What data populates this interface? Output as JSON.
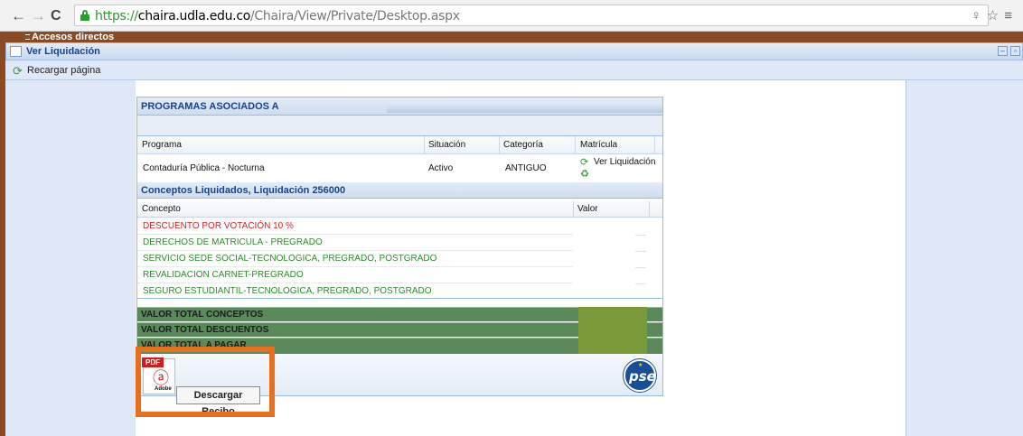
{
  "browser": {
    "url_scheme": "https://",
    "url_host": "chaira.udla.edu.co",
    "url_path": "/Chaira/View/Private/Desktop.aspx"
  },
  "app": {
    "shortcuts_label": "Accesos directos"
  },
  "window": {
    "title": "Ver Liquidación"
  },
  "toolbar": {
    "reload_label": "Recargar página"
  },
  "programs": {
    "header": "PROGRAMAS ASOCIADOS A",
    "columns": [
      "Programa",
      "Situación",
      "Categoría",
      "Matrícula"
    ],
    "rows": [
      {
        "programa": "Contaduría Pública - Nocturna",
        "situacion": "Activo",
        "categoria": "ANTIGUO",
        "matricula_link": "Ver Liquidación"
      }
    ]
  },
  "concepts": {
    "header": "Conceptos Liquidados, Liquidación 256000",
    "columns": [
      "Concepto",
      "Valor"
    ],
    "rows": [
      {
        "label": "DESCUENTO POR VOTACIÓN 10 %",
        "color": "#e02020"
      },
      {
        "label": "DERECHOS DE MATRICULA - PREGRADO",
        "color": "#2e8b2e"
      },
      {
        "label": "SERVICIO SEDE SOCIAL-TECNOLOGICA, PREGRADO, POSTGRADO",
        "color": "#2e8b2e"
      },
      {
        "label": "REVALIDACION CARNET-PREGRADO",
        "color": "#2e8b2e"
      },
      {
        "label": "SEGURO ESTUDIANTIL-TECNOLOGICA, PREGRADO, POSTGRADO",
        "color": "#2e8b2e"
      }
    ]
  },
  "totals": {
    "conceptos": "VALOR TOTAL CONCEPTOS",
    "descuentos": "VALOR TOTAL DESCUENTOS",
    "pagar": "VALOR TOTAL A PAGAR"
  },
  "download": {
    "pdf_tag": "PDF",
    "adobe_label": "Adobe",
    "tooltip": "Descargar Recibo"
  },
  "pse": {
    "label": "pse"
  }
}
